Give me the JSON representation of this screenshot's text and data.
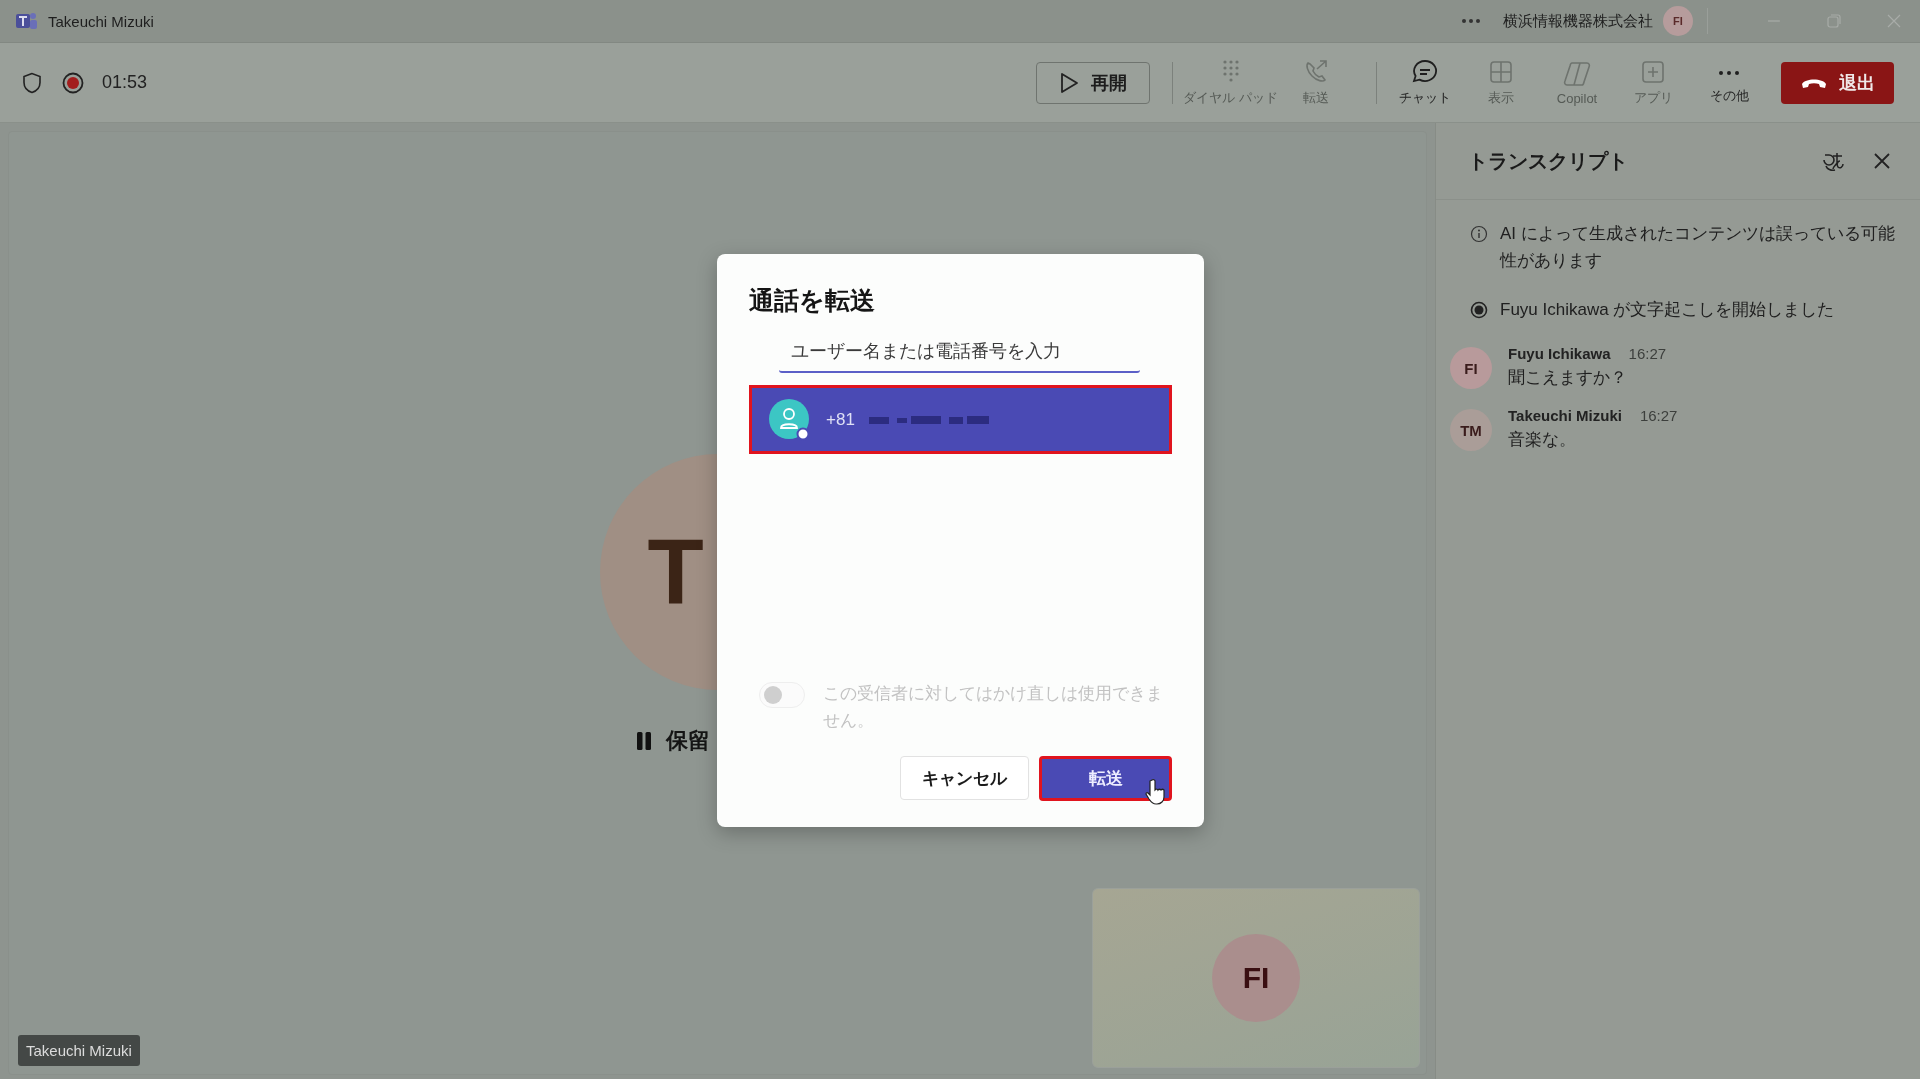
{
  "window": {
    "title": "Takeuchi Mizuki",
    "org": "横浜情報機器株式会社",
    "account_initials": "FI"
  },
  "call_bar": {
    "timer": "01:53",
    "recording": true,
    "resume": "再開",
    "tools": [
      {
        "kind": "dialpad",
        "label": "ダイヤル パッド",
        "disabled": true
      },
      {
        "kind": "transfer",
        "label": "転送",
        "disabled": true
      },
      {
        "kind": "chat",
        "label": "チャット",
        "disabled": false
      },
      {
        "kind": "view",
        "label": "表示",
        "disabled": true
      },
      {
        "kind": "copilot",
        "label": "Copilot",
        "disabled": true
      },
      {
        "kind": "apps",
        "label": "アプリ",
        "disabled": true
      },
      {
        "kind": "more",
        "label": "その他",
        "disabled": false
      }
    ],
    "leave": "退出"
  },
  "stage": {
    "avatar_initials": "T",
    "hold_label": "保留",
    "name_tag": "Takeuchi Mizuki",
    "self_view_initials": "FI"
  },
  "dialog": {
    "title": "通話を転送",
    "search": {
      "placeholder": "ユーザー名または電話番号を入力"
    },
    "results": [
      {
        "number": "+81",
        "selected": true,
        "highlighted": true
      }
    ],
    "callback": {
      "on": false,
      "disabled": true,
      "label": "この受信者に対してはかけ直しは使用できません。"
    },
    "buttons": [
      {
        "kind": "secondary",
        "label": "キャンセル",
        "highlighted": false
      },
      {
        "kind": "primary",
        "label": "転送",
        "highlighted": true
      }
    ]
  },
  "transcript": {
    "title": "トランスクリプト",
    "notices": [
      {
        "kind": "info",
        "text": "AI によって生成されたコンテンツは誤っている可能性があります"
      },
      {
        "kind": "recording",
        "text": "Fuyu Ichikawa が文字起こしを開始しました"
      }
    ],
    "entries": [
      {
        "initials": "FI",
        "color": "#b89a9b",
        "name": "Fuyu Ichikawa",
        "time": "16:27",
        "text": "聞こえますか？"
      },
      {
        "initials": "TM",
        "color": "#aa9d98",
        "name": "Takeuchi Mizuki",
        "time": "16:27",
        "text": "音楽な。"
      }
    ]
  }
}
